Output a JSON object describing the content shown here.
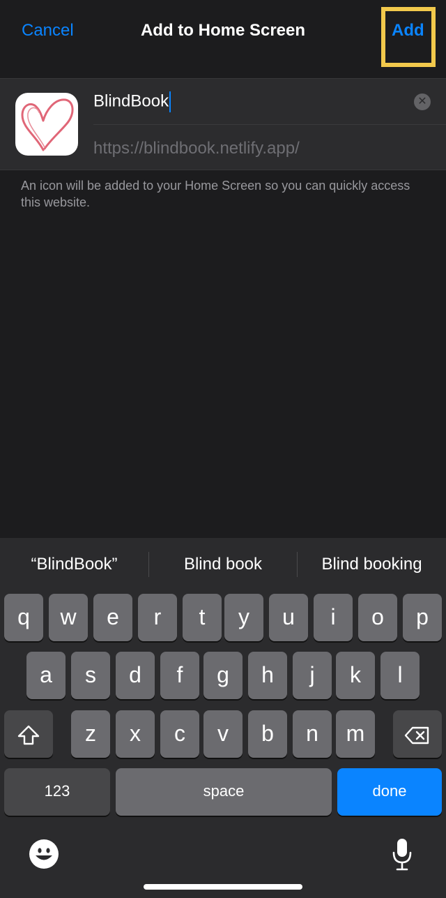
{
  "nav": {
    "cancel_label": "Cancel",
    "title": "Add to Home Screen",
    "add_label": "Add"
  },
  "form": {
    "name_value": "BlindBook",
    "url": "https://blindbook.netlify.app/",
    "clear_icon": "clear-x-icon"
  },
  "footnote": "An icon will be added to your Home Screen so you can quickly access this website.",
  "keyboard": {
    "suggestions": [
      "“BlindBook”",
      "Blind book",
      "Blind booking"
    ],
    "row1": [
      "q",
      "w",
      "e",
      "r",
      "t",
      "y",
      "u",
      "i",
      "o",
      "p"
    ],
    "row2": [
      "a",
      "s",
      "d",
      "f",
      "g",
      "h",
      "j",
      "k",
      "l"
    ],
    "row3": [
      "z",
      "x",
      "c",
      "v",
      "b",
      "n",
      "m"
    ],
    "numbers_label": "123",
    "space_label": "space",
    "done_label": "done",
    "shift_icon": "shift-arrow-icon",
    "delete_icon": "backspace-icon",
    "emoji_icon": "emoji-icon",
    "mic_icon": "microphone-icon"
  },
  "colors": {
    "accent": "#0a84ff",
    "highlight": "#f2c94c",
    "background": "#1c1c1e"
  }
}
